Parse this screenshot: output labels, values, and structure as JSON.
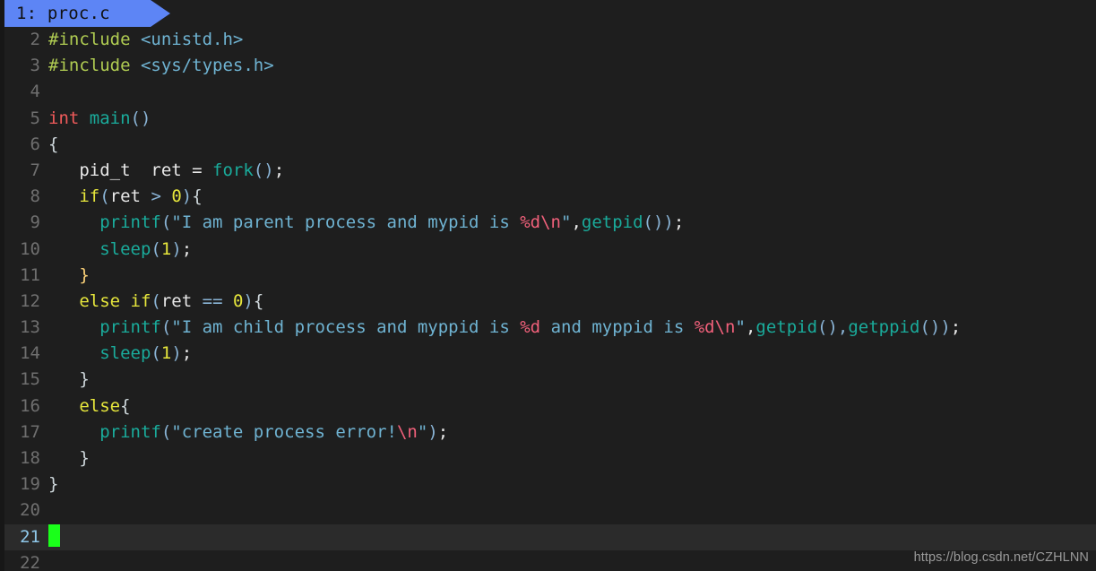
{
  "tab": {
    "label": "1: proc.c"
  },
  "watermark": "https://blog.csdn.net/CZHLNN",
  "editor": {
    "filename": "proc.c",
    "cursor_line": 21,
    "background_color": "#1e1e1e",
    "active_line_color": "#2b2b2b",
    "tab_color": "#5d85f5",
    "cursor_color": "#1aff1a"
  },
  "lines": [
    {
      "n": "2",
      "segments": [
        {
          "c": "t-pre",
          "t": "#include"
        },
        {
          "c": "t-plain",
          "t": " "
        },
        {
          "c": "t-hdr",
          "t": "<unistd.h>"
        }
      ]
    },
    {
      "n": "3",
      "segments": [
        {
          "c": "t-pre",
          "t": "#include"
        },
        {
          "c": "t-plain",
          "t": " "
        },
        {
          "c": "t-hdr",
          "t": "<sys/types.h>"
        }
      ]
    },
    {
      "n": "4",
      "segments": []
    },
    {
      "n": "5",
      "segments": [
        {
          "c": "t-kw",
          "t": "int"
        },
        {
          "c": "t-plain",
          "t": " "
        },
        {
          "c": "t-fn",
          "t": "main"
        },
        {
          "c": "t-op",
          "t": "()"
        }
      ]
    },
    {
      "n": "6",
      "segments": [
        {
          "c": "t-punct",
          "t": "{"
        }
      ]
    },
    {
      "n": "7",
      "segments": [
        {
          "c": "t-plain",
          "t": "   pid_t  ret = "
        },
        {
          "c": "t-fn",
          "t": "fork"
        },
        {
          "c": "t-op",
          "t": "()"
        },
        {
          "c": "t-plain",
          "t": ";"
        }
      ]
    },
    {
      "n": "8",
      "segments": [
        {
          "c": "t-plain",
          "t": "   "
        },
        {
          "c": "t-kw2",
          "t": "if"
        },
        {
          "c": "t-op",
          "t": "("
        },
        {
          "c": "t-plain",
          "t": "ret "
        },
        {
          "c": "t-op",
          "t": ">"
        },
        {
          "c": "t-plain",
          "t": " "
        },
        {
          "c": "t-num",
          "t": "0"
        },
        {
          "c": "t-op",
          "t": ")"
        },
        {
          "c": "t-punct",
          "t": "{"
        }
      ]
    },
    {
      "n": "9",
      "segments": [
        {
          "c": "t-plain",
          "t": "     "
        },
        {
          "c": "t-fn",
          "t": "printf"
        },
        {
          "c": "t-op",
          "t": "("
        },
        {
          "c": "t-str",
          "t": "\"I am parent process and mypid is "
        },
        {
          "c": "t-esc",
          "t": "%d\\n"
        },
        {
          "c": "t-str",
          "t": "\""
        },
        {
          "c": "t-plain",
          "t": ","
        },
        {
          "c": "t-fn",
          "t": "getpid"
        },
        {
          "c": "t-op",
          "t": "())"
        },
        {
          "c": "t-plain",
          "t": ";"
        }
      ]
    },
    {
      "n": "10",
      "segments": [
        {
          "c": "t-plain",
          "t": "     "
        },
        {
          "c": "t-fn",
          "t": "sleep"
        },
        {
          "c": "t-op",
          "t": "("
        },
        {
          "c": "t-num",
          "t": "1"
        },
        {
          "c": "t-op",
          "t": ")"
        },
        {
          "c": "t-plain",
          "t": ";"
        }
      ]
    },
    {
      "n": "11",
      "segments": [
        {
          "c": "t-plain",
          "t": "   "
        },
        {
          "c": "t-brace",
          "t": "}"
        }
      ]
    },
    {
      "n": "12",
      "segments": [
        {
          "c": "t-plain",
          "t": "   "
        },
        {
          "c": "t-kw2",
          "t": "else if"
        },
        {
          "c": "t-op",
          "t": "("
        },
        {
          "c": "t-plain",
          "t": "ret "
        },
        {
          "c": "t-op",
          "t": "=="
        },
        {
          "c": "t-plain",
          "t": " "
        },
        {
          "c": "t-num",
          "t": "0"
        },
        {
          "c": "t-op",
          "t": ")"
        },
        {
          "c": "t-punct",
          "t": "{"
        }
      ]
    },
    {
      "n": "13",
      "segments": [
        {
          "c": "t-plain",
          "t": "     "
        },
        {
          "c": "t-fn",
          "t": "printf"
        },
        {
          "c": "t-op",
          "t": "("
        },
        {
          "c": "t-str",
          "t": "\"I am child process and myppid is "
        },
        {
          "c": "t-esc",
          "t": "%d"
        },
        {
          "c": "t-str",
          "t": " and myppid is "
        },
        {
          "c": "t-esc",
          "t": "%d\\n"
        },
        {
          "c": "t-str",
          "t": "\""
        },
        {
          "c": "t-plain",
          "t": ","
        },
        {
          "c": "t-fn",
          "t": "getpid"
        },
        {
          "c": "t-op",
          "t": "(),"
        },
        {
          "c": "t-fn",
          "t": "getppid"
        },
        {
          "c": "t-op",
          "t": "())"
        },
        {
          "c": "t-plain",
          "t": ";"
        }
      ]
    },
    {
      "n": "14",
      "segments": [
        {
          "c": "t-plain",
          "t": "     "
        },
        {
          "c": "t-fn",
          "t": "sleep"
        },
        {
          "c": "t-op",
          "t": "("
        },
        {
          "c": "t-num",
          "t": "1"
        },
        {
          "c": "t-op",
          "t": ")"
        },
        {
          "c": "t-plain",
          "t": ";"
        }
      ]
    },
    {
      "n": "15",
      "segments": [
        {
          "c": "t-plain",
          "t": "   "
        },
        {
          "c": "t-punct",
          "t": "}"
        }
      ]
    },
    {
      "n": "16",
      "segments": [
        {
          "c": "t-plain",
          "t": "   "
        },
        {
          "c": "t-kw2",
          "t": "else"
        },
        {
          "c": "t-punct",
          "t": "{"
        }
      ]
    },
    {
      "n": "17",
      "segments": [
        {
          "c": "t-plain",
          "t": "     "
        },
        {
          "c": "t-fn",
          "t": "printf"
        },
        {
          "c": "t-op",
          "t": "("
        },
        {
          "c": "t-str",
          "t": "\"create process error!"
        },
        {
          "c": "t-esc",
          "t": "\\n"
        },
        {
          "c": "t-str",
          "t": "\""
        },
        {
          "c": "t-op",
          "t": ")"
        },
        {
          "c": "t-plain",
          "t": ";"
        }
      ]
    },
    {
      "n": "18",
      "segments": [
        {
          "c": "t-plain",
          "t": "   "
        },
        {
          "c": "t-punct",
          "t": "}"
        }
      ]
    },
    {
      "n": "19",
      "segments": [
        {
          "c": "t-punct",
          "t": "}"
        }
      ]
    },
    {
      "n": "20",
      "segments": []
    },
    {
      "n": "21",
      "segments": [],
      "active": true,
      "cursor": true
    },
    {
      "n": "22",
      "segments": []
    }
  ]
}
